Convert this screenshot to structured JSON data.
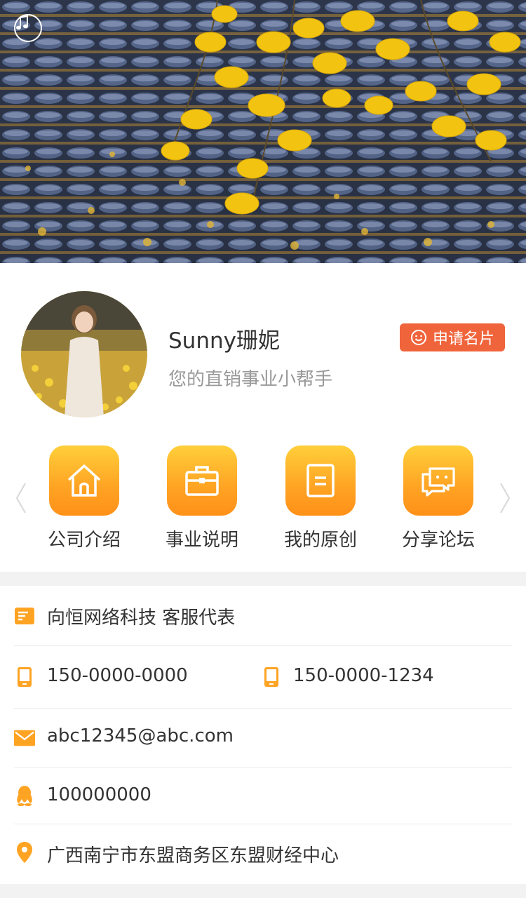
{
  "banner": {
    "music_icon": "music-note-icon"
  },
  "profile": {
    "name": "Sunny珊妮",
    "slogan": "您的直销事业小帮手",
    "apply_button": "申请名片",
    "apply_icon": "smiley-icon"
  },
  "menu": {
    "items": [
      {
        "label": "公司介绍",
        "icon": "house-icon"
      },
      {
        "label": "事业说明",
        "icon": "briefcase-icon"
      },
      {
        "label": "我的原创",
        "icon": "document-icon"
      },
      {
        "label": "分享论坛",
        "icon": "chat-bubbles-icon"
      }
    ],
    "prev_icon": "chevron-left-icon",
    "next_icon": "chevron-right-icon"
  },
  "contacts": {
    "company": "向恒网络科技 客服代表",
    "phone1": "150-0000-0000",
    "phone2": "150-0000-1234",
    "email": "abc12345@abc.com",
    "qq": "100000000",
    "address": "广西南宁市东盟商务区东盟财经中心"
  },
  "colors": {
    "accent_orange": "#ffa323",
    "apply_red": "#f0643c",
    "text_dark": "#333333",
    "text_gray": "#999999",
    "divider": "#ebebeb",
    "page_bg": "#f2f2f2"
  }
}
